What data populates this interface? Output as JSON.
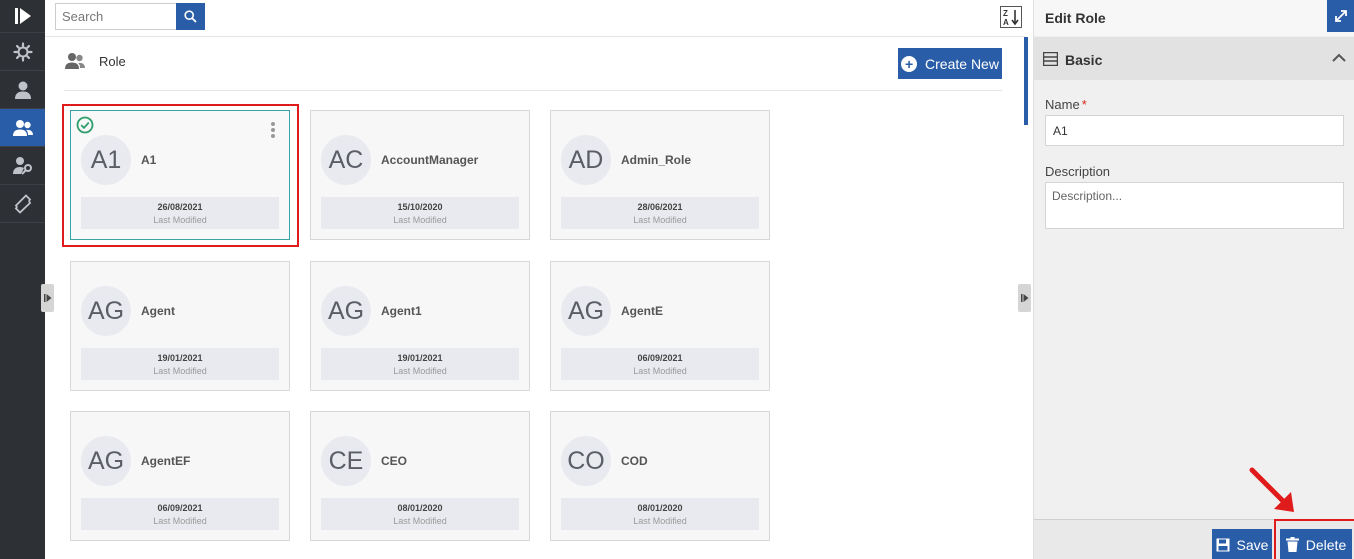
{
  "search": {
    "placeholder": "Search"
  },
  "sidebar": {
    "items": [
      {
        "name": "logo",
        "icon": "play-logo-icon"
      },
      {
        "name": "settings",
        "icon": "gear-icon"
      },
      {
        "name": "users",
        "icon": "user-icon"
      },
      {
        "name": "roles",
        "icon": "user-group-icon",
        "active": true
      },
      {
        "name": "permissions",
        "icon": "user-key-icon"
      },
      {
        "name": "tickets",
        "icon": "ticket-icon"
      }
    ]
  },
  "header": {
    "section_title": "Role",
    "create_label": "Create New"
  },
  "cards": [
    {
      "initials": "A1",
      "name": "A1",
      "date": "26/08/2021",
      "modified_label": "Last Modified",
      "selected": true
    },
    {
      "initials": "AC",
      "name": "AccountManager",
      "date": "15/10/2020",
      "modified_label": "Last Modified"
    },
    {
      "initials": "AD",
      "name": "Admin_Role",
      "date": "28/06/2021",
      "modified_label": "Last Modified"
    },
    {
      "initials": "AG",
      "name": "Agent",
      "date": "19/01/2021",
      "modified_label": "Last Modified"
    },
    {
      "initials": "AG",
      "name": "Agent1",
      "date": "19/01/2021",
      "modified_label": "Last Modified"
    },
    {
      "initials": "AG",
      "name": "AgentE",
      "date": "06/09/2021",
      "modified_label": "Last Modified"
    },
    {
      "initials": "AG",
      "name": "AgentEF",
      "date": "06/09/2021",
      "modified_label": "Last Modified"
    },
    {
      "initials": "CE",
      "name": "CEO",
      "date": "08/01/2020",
      "modified_label": "Last Modified"
    },
    {
      "initials": "CO",
      "name": "COD",
      "date": "08/01/2020",
      "modified_label": "Last Modified"
    }
  ],
  "edit_panel": {
    "title": "Edit Role",
    "section": "Basic",
    "name_label": "Name",
    "required_mark": "*",
    "name_value": "A1",
    "description_label": "Description",
    "description_placeholder": "Description...",
    "save_label": "Save",
    "delete_label": "Delete"
  },
  "colors": {
    "accent": "#2a5da8",
    "sidebar_bg": "#2d3035",
    "highlight": "#e01b1b",
    "check": "#2e9e6b"
  }
}
